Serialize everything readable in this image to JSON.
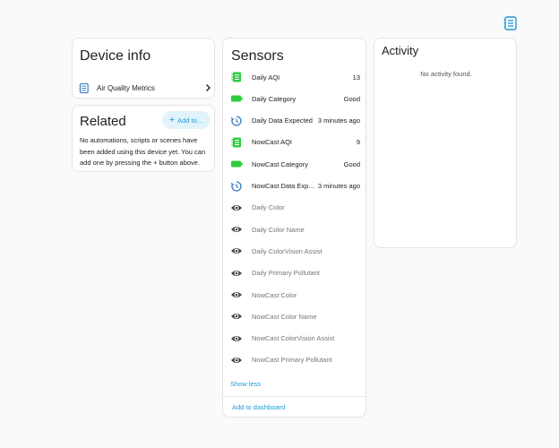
{
  "device_info": {
    "title": "Device info",
    "device_label": "Air Quality Metrics"
  },
  "related": {
    "title": "Related",
    "add_button_label": "Add to…",
    "empty_text": "No automations, scripts or scenes have been added using this device yet. You can add one by pressing the + button above."
  },
  "sensors": {
    "title": "Sensors",
    "items": [
      {
        "name": "Daily AQI",
        "value": "13",
        "icon": "counter-icon"
      },
      {
        "name": "Daily Category",
        "value": "Good",
        "icon": "battery-icon"
      },
      {
        "name": "Daily Data Expected",
        "value": "3 minutes ago",
        "icon": "clock-icon"
      },
      {
        "name": "NowCast AQI",
        "value": "9",
        "icon": "counter-icon"
      },
      {
        "name": "NowCast Category",
        "value": "Good",
        "icon": "battery-icon"
      },
      {
        "name": "NowCast Data Expected",
        "value": "3 minutes ago",
        "icon": "clock-icon"
      },
      {
        "name": "Daily Color",
        "value": "",
        "icon": "eye-icon"
      },
      {
        "name": "Daily Color Name",
        "value": "",
        "icon": "eye-icon"
      },
      {
        "name": "Daily ColorVision Assist",
        "value": "",
        "icon": "eye-icon"
      },
      {
        "name": "Daily Primary Pollutant",
        "value": "",
        "icon": "eye-icon"
      },
      {
        "name": "NowCast Color",
        "value": "",
        "icon": "eye-icon"
      },
      {
        "name": "NowCast Color Name",
        "value": "",
        "icon": "eye-icon"
      },
      {
        "name": "NowCast ColorVision Assist",
        "value": "",
        "icon": "eye-icon"
      },
      {
        "name": "NowCast Primary Pollutant",
        "value": "",
        "icon": "eye-icon"
      }
    ],
    "show_less_label": "Show less",
    "add_dashboard_label": "Add to dashboard"
  },
  "activity": {
    "title": "Activity",
    "empty_text": "No activity found."
  },
  "colors": {
    "accent": "#1e9ad6",
    "green": "#2ecc40",
    "blue_icon": "#3a7bbf",
    "eye": "#424242"
  }
}
